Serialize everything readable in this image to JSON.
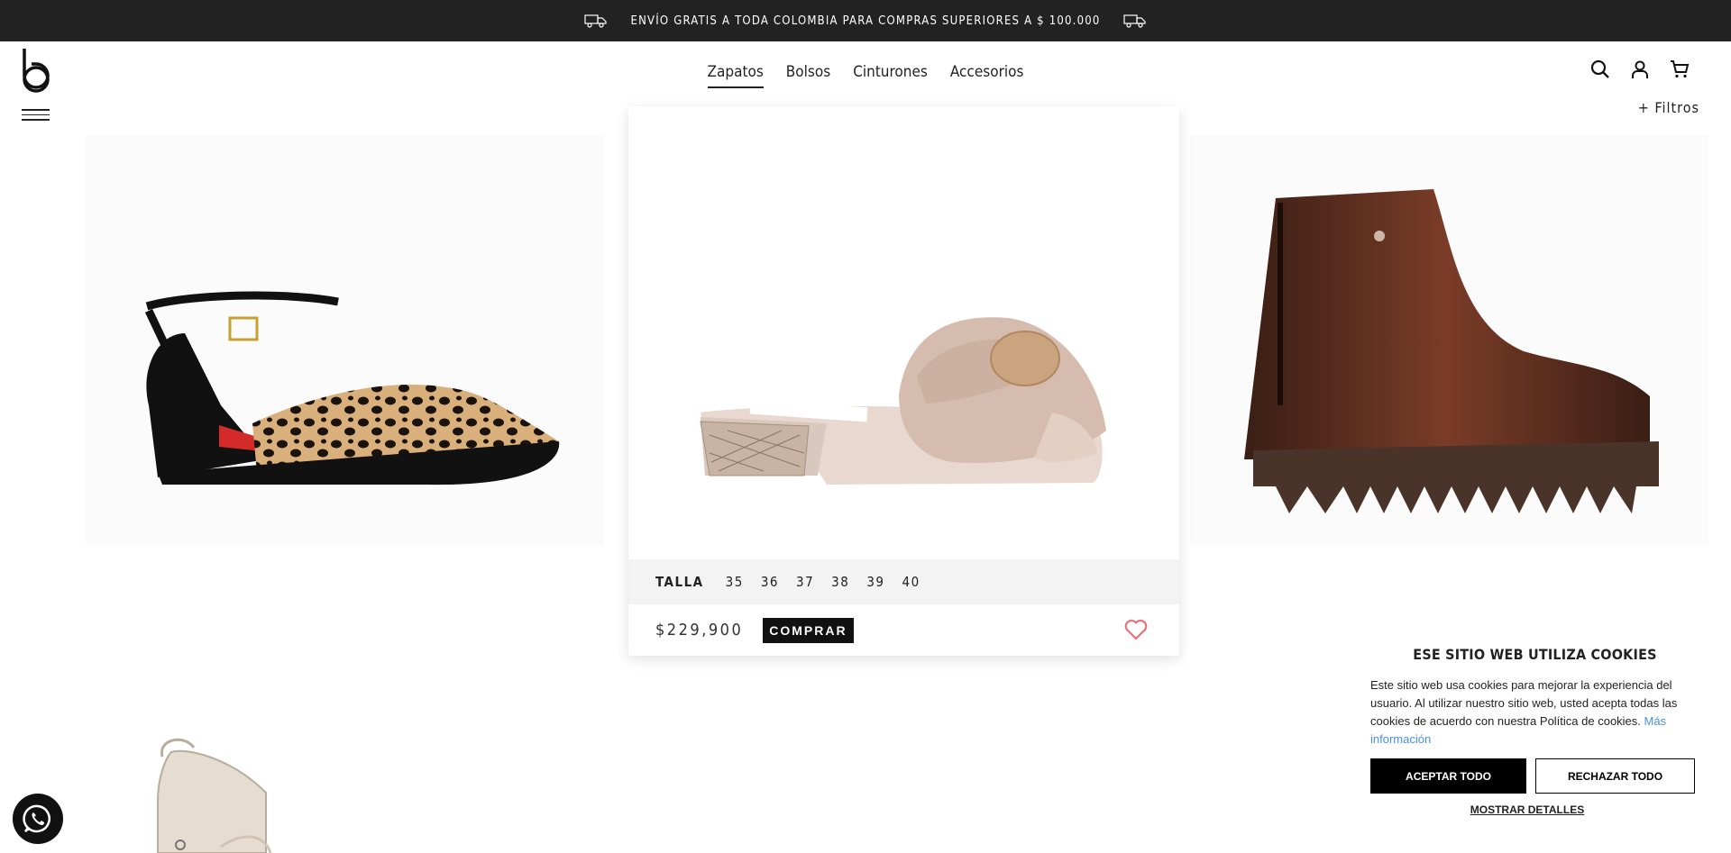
{
  "topbar": {
    "message": "ENVÍO GRATIS A TODA COLOMBIA PARA COMPRAS SUPERIORES A $ 100.000"
  },
  "nav": {
    "items": [
      "Zapatos",
      "Bolsos",
      "Cinturones",
      "Accesorios"
    ],
    "active": "Zapatos"
  },
  "header_icons": [
    "search-icon",
    "user-icon",
    "cart-icon"
  ],
  "filters": {
    "label": "+ Filtros"
  },
  "featured_product": {
    "size_label": "TALLA",
    "sizes": [
      "35",
      "36",
      "37",
      "38",
      "39",
      "40"
    ],
    "price": "$229,900",
    "buy_label": "COMPRAR"
  },
  "cookie": {
    "title": "ESE SITIO WEB UTILIZA COOKIES",
    "text": "Este sitio web usa cookies para mejorar la experiencia del usuario. Al utilizar nuestro sitio web, usted acepta todas las cookies de acuerdo con nuestra Política de cookies.",
    "link": "Más información",
    "accept": "ACEPTAR TODO",
    "reject": "RECHAZAR TODO",
    "details": "MOSTRAR DETALLES"
  },
  "colors": {
    "topbar": "#222222",
    "accent_heart": "#e8707a",
    "link": "#4a90e2"
  }
}
